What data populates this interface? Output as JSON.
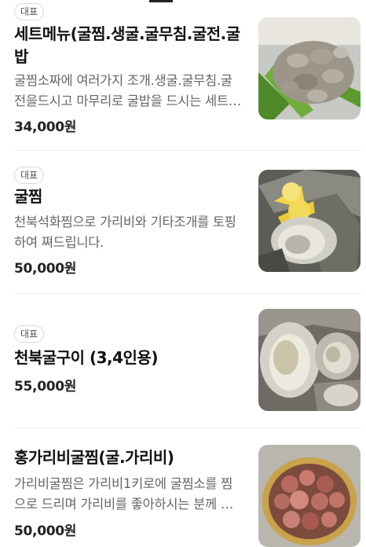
{
  "menu": {
    "items": [
      {
        "badge": "대표",
        "title": "세트메뉴(굴찜.생굴.굴무침.굴전.굴밥",
        "description": "굴찜소짜에 여러가지 조개.생굴.굴무침.굴전을드시고 마무리로 굴밥을 드시는 세트메뉴입니다.",
        "price": "34,000원",
        "image": "oyster-set-photo"
      },
      {
        "badge": "대표",
        "title": "굴찜",
        "description": "천북석화찜으로 가리비와 기타조개를 토핑하여 쪄드립니다.",
        "price": "50,000원",
        "image": "steamed-oyster-photo"
      },
      {
        "badge": "대표",
        "title": "천북굴구이 (3,4인용)",
        "description": "",
        "price": "55,000원",
        "image": "grilled-oyster-photo"
      },
      {
        "badge": "",
        "title": "홍가리비굴찜(굴.가리비)",
        "description": "가리비굴찜은 가리비1키로에 굴찜소를 찜으로 드리며 가리비를 좋아하시는 분께 추천합니다.",
        "price": "50,000원",
        "image": "scallop-oyster-photo"
      }
    ]
  }
}
